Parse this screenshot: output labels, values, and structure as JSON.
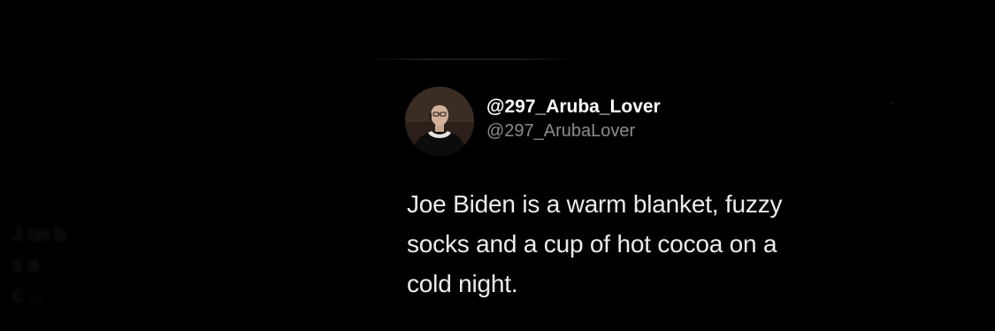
{
  "tweet": {
    "display_name": "@297_Aruba_Lover",
    "handle": "@297_ArubaLover",
    "text_lines": [
      "Joe Biden is a warm blanket, fuzzy",
      "socks and a cup of hot cocoa on a",
      "cold night."
    ],
    "avatar_icon": "profile-photo"
  },
  "background_ghost": {
    "lines": [
      "J     on b",
      "s                                    a",
      "c      ..."
    ]
  },
  "colors": {
    "background": "#000000",
    "name": "#ffffff",
    "handle": "#8b8b8b",
    "text": "#ececec"
  }
}
